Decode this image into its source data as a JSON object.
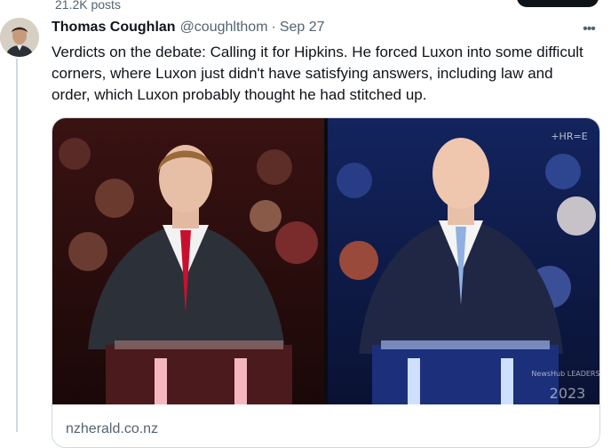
{
  "header": {
    "posts_count": "21.2K posts"
  },
  "tweet": {
    "author_name": "Thomas Coughlan",
    "author_handle": "@coughlthom",
    "separator": "·",
    "date": "Sep 27",
    "more_icon": "more-horizontal-icon",
    "text": "Verdicts on the debate: Calling it for Hipkins. He forced Luxon into some difficult corners, where Luxon just didn't have satisfying answers, including law and order, which Luxon probably thought he had stitched up."
  },
  "card": {
    "domain": "nzherald.co.nz",
    "watermark_top": "+HR=E",
    "watermark_bottom": "2023",
    "watermark_mid": "NewsHub LEADERS"
  },
  "colors": {
    "text": "#0f1419",
    "secondary": "#536471",
    "border": "#cfd9de",
    "stage_left": "#2a0f10",
    "stage_right": "#0c1a4a"
  }
}
